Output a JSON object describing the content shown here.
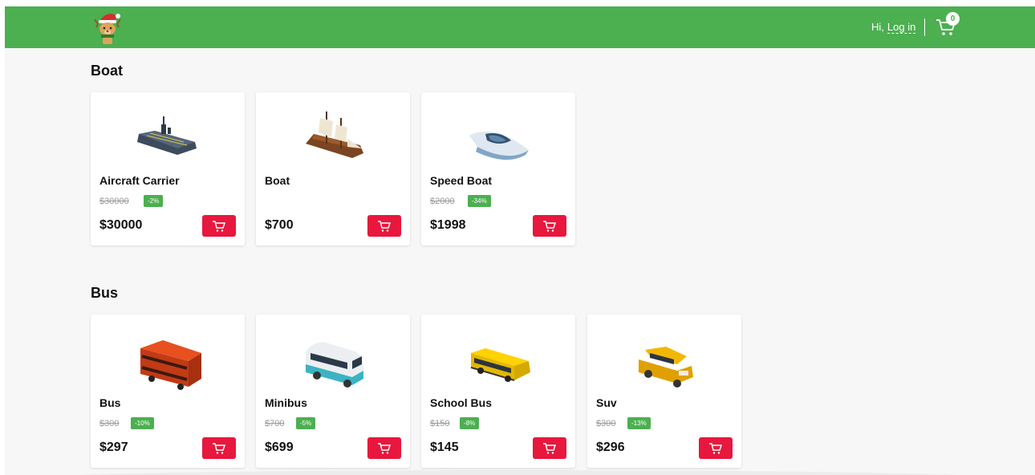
{
  "header": {
    "greeting": "Hi,",
    "login_label": "Log in",
    "cart_count": "0",
    "brand_color": "#4caf50"
  },
  "sections": [
    {
      "title": "Boat",
      "products": [
        {
          "name": "Aircraft Carrier",
          "old_price": "$30000",
          "discount": "-2%",
          "price": "$30000",
          "icon": "aircraft-carrier-image"
        },
        {
          "name": "Boat",
          "old_price": "",
          "discount": "",
          "price": "$700",
          "icon": "sailing-ship-image"
        },
        {
          "name": "Speed Boat",
          "old_price": "$2000",
          "discount": "-34%",
          "price": "$1998",
          "icon": "speed-boat-image"
        }
      ]
    },
    {
      "title": "Bus",
      "products": [
        {
          "name": "Bus",
          "old_price": "$300",
          "discount": "-10%",
          "price": "$297",
          "icon": "double-decker-bus-image"
        },
        {
          "name": "Minibus",
          "old_price": "$700",
          "discount": "-5%",
          "price": "$699",
          "icon": "minibus-image"
        },
        {
          "name": "School Bus",
          "old_price": "$150",
          "discount": "-8%",
          "price": "$145",
          "icon": "school-bus-image"
        },
        {
          "name": "Suv",
          "old_price": "$300",
          "discount": "-13%",
          "price": "$296",
          "icon": "suv-image"
        }
      ]
    }
  ],
  "colors": {
    "add_button": "#e8173d",
    "discount_badge": "#4caf50"
  }
}
